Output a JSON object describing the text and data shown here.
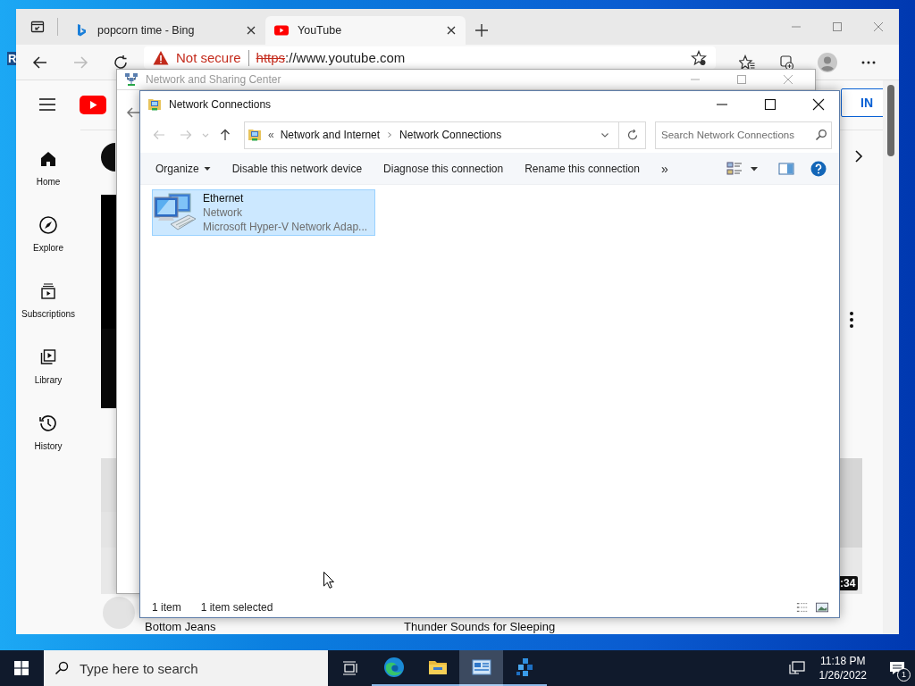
{
  "desktop": {
    "icon_label": "R"
  },
  "browser": {
    "tabs": [
      {
        "title": "popcorn time - Bing",
        "kind": "bing",
        "selected": false
      },
      {
        "title": "YouTube",
        "kind": "youtube",
        "selected": true
      }
    ],
    "address": {
      "security": "Not secure",
      "scheme": "https",
      "rest": "://www.youtube.com"
    },
    "youtube": {
      "sidebar": [
        {
          "kind": "home",
          "label": "Home"
        },
        {
          "kind": "explore",
          "label": "Explore"
        },
        {
          "kind": "subscriptions",
          "label": "Subscriptions"
        },
        {
          "kind": "library",
          "label": "Library"
        },
        {
          "kind": "history",
          "label": "History"
        }
      ],
      "sign_in": "IN",
      "duration": ":34",
      "video_titles": [
        "Bottom Jeans",
        "Thunder Sounds for Sleeping"
      ]
    }
  },
  "sharing_center": {
    "title": "Network and Sharing Center",
    "active": false
  },
  "explorer": {
    "title": "Network Connections",
    "active": true,
    "breadcrumb_overflow": "«",
    "breadcrumb": [
      "Network and Internet",
      "Network Connections"
    ],
    "search": {
      "placeholder": "Search Network Connections"
    },
    "commands": [
      {
        "kind": "menu",
        "label": "Organize"
      },
      {
        "kind": "button",
        "label": "Disable this network device"
      },
      {
        "kind": "button",
        "label": "Diagnose this connection"
      },
      {
        "kind": "button",
        "label": "Rename this connection"
      },
      {
        "kind": "overflow",
        "label": "»"
      }
    ],
    "items": [
      {
        "name": "Ethernet",
        "status": "Network",
        "device": "Microsoft Hyper-V Network Adap...",
        "selected": true
      }
    ],
    "status_bar": {
      "count": "1 item",
      "selection": "1 item selected"
    }
  },
  "taskbar": {
    "search_placeholder": "Type here to search",
    "apps": [
      {
        "kind": "edge",
        "active": false
      },
      {
        "kind": "folder",
        "active": false
      },
      {
        "kind": "control-panel",
        "active": true
      },
      {
        "kind": "network",
        "active": false
      }
    ],
    "clock": {
      "time": "11:18 PM",
      "date": "1/26/2022"
    },
    "notification_count": "1"
  }
}
